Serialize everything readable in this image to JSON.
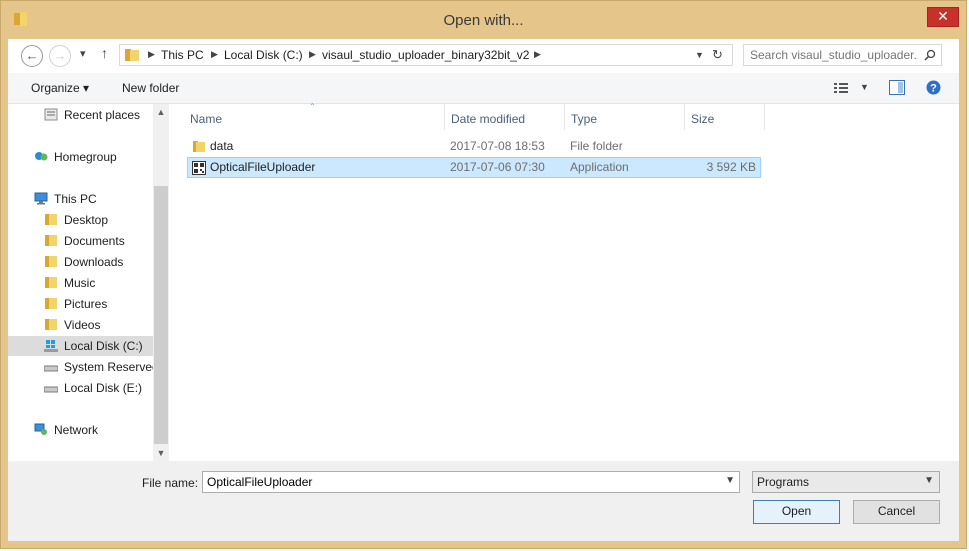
{
  "window": {
    "title": "Open with...",
    "close_label": "✕"
  },
  "address": {
    "back": "←",
    "forward": "→",
    "recent": "▾",
    "up": "↑",
    "crumbs": [
      "This PC",
      "Local Disk (C:)",
      "visaul_studio_uploader_binary32bit_v2"
    ],
    "refresh": "↻",
    "search_placeholder": "Search visaul_studio_uploader..."
  },
  "toolbar": {
    "organize": "Organize ▾",
    "new_folder": "New folder"
  },
  "navpane": {
    "items": [
      {
        "label": "Recent places",
        "icon": "recent-places-icon"
      },
      {
        "label": "Homegroup",
        "icon": "homegroup-icon"
      },
      {
        "label": "This PC",
        "icon": "computer-icon"
      },
      {
        "label": "Desktop",
        "icon": "folder-icon"
      },
      {
        "label": "Documents",
        "icon": "folder-icon"
      },
      {
        "label": "Downloads",
        "icon": "folder-icon"
      },
      {
        "label": "Music",
        "icon": "folder-icon"
      },
      {
        "label": "Pictures",
        "icon": "folder-icon"
      },
      {
        "label": "Videos",
        "icon": "folder-icon"
      },
      {
        "label": "Local Disk (C:)",
        "icon": "drive-icon",
        "selected": true
      },
      {
        "label": "System Reserved",
        "icon": "drive-icon"
      },
      {
        "label": "Local Disk (E:)",
        "icon": "drive-icon"
      },
      {
        "label": "Network",
        "icon": "network-icon"
      }
    ]
  },
  "filelist": {
    "columns": [
      "Name",
      "Date modified",
      "Type",
      "Size"
    ],
    "rows": [
      {
        "name": "data",
        "date": "2017-07-08 18:53",
        "type": "File folder",
        "size": "",
        "icon": "folder-icon"
      },
      {
        "name": "OpticalFileUploader",
        "date": "2017-07-06 07:30",
        "type": "Application",
        "size": "3 592 KB",
        "icon": "application-icon",
        "selected": true
      }
    ]
  },
  "bottom": {
    "filename_label": "File name:",
    "filename_value": "OpticalFileUploader",
    "filetype": "Programs",
    "open": "Open",
    "cancel": "Cancel"
  },
  "colors": {
    "accent": "#0078d7",
    "selection": "#cce8ff",
    "titlebar": "#e6c58a",
    "close": "#c7302b"
  }
}
